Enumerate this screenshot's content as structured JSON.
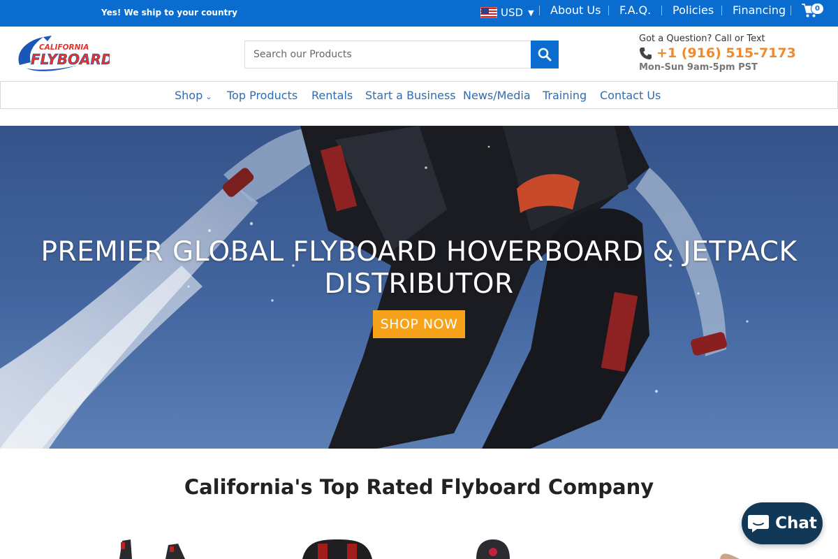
{
  "topbar": {
    "ship_message": "Yes! We ship to your country",
    "currency": "USD",
    "links": [
      "About Us",
      "F.A.Q.",
      "Policies",
      "Financing"
    ],
    "cart_count": "0"
  },
  "header": {
    "logo_line1": "CALIFORNIA",
    "logo_line2": "FLYBOARD",
    "search_placeholder": "Search our Products",
    "contact_question": "Got a Question? Call or Text",
    "contact_phone": "+1 (916) 515-7173",
    "contact_hours": "Mon-Sun 9am-5pm PST"
  },
  "nav": {
    "items": [
      "Shop",
      "Top Products",
      "Rentals",
      "Start a Business",
      "News/Media",
      "Training",
      "Contact Us"
    ]
  },
  "hero": {
    "title_line1": "PREMIER GLOBAL FLYBOARD HOVERBOARD & JETPACK",
    "title_line2": "DISTRIBUTOR",
    "cta": "SHOP NOW"
  },
  "section": {
    "title": "California's Top Rated Flyboard Company"
  },
  "chat": {
    "label": "Chat"
  },
  "colors": {
    "brand_blue": "#0a6ccf",
    "phone_orange": "#f08a2e",
    "cta_orange": "#f7a21b",
    "chat_navy": "#113856",
    "nav_link": "#2e6db4"
  }
}
